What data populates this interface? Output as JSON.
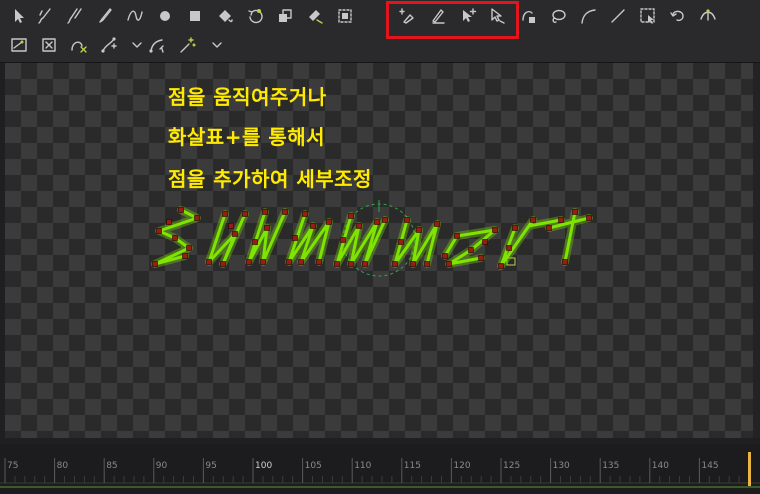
{
  "toolbar": {
    "row1": [
      {
        "id": "select",
        "icon": "arrow-select-icon"
      },
      {
        "id": "brush-a",
        "icon": "paint-brush-icon"
      },
      {
        "id": "brush-b",
        "icon": "multi-stroke-brush-icon"
      },
      {
        "id": "brush-c",
        "icon": "pencil-brush-icon"
      },
      {
        "id": "curve",
        "icon": "bezier-curve-icon"
      },
      {
        "id": "circle",
        "icon": "circle-icon"
      },
      {
        "id": "square",
        "icon": "square-icon"
      },
      {
        "id": "fill",
        "icon": "fill-bucket-icon"
      },
      {
        "id": "rotate",
        "icon": "rotate-shape-icon"
      },
      {
        "id": "layers",
        "icon": "layer-stack-icon"
      },
      {
        "id": "paint-clear",
        "icon": "paint-clear-icon"
      },
      {
        "id": "frame",
        "icon": "frame-select-icon"
      },
      {
        "id": "add-point",
        "icon": "pen-add-point-icon"
      },
      {
        "id": "pen",
        "icon": "pen-draw-icon"
      },
      {
        "id": "arrow-plus",
        "icon": "arrow-add-point-icon"
      },
      {
        "id": "arrow-modify",
        "icon": "arrow-modify-point-icon"
      },
      {
        "id": "lock-shape",
        "icon": "lock-shape-icon"
      },
      {
        "id": "lasso",
        "icon": "lasso-icon"
      },
      {
        "id": "arc",
        "icon": "arc-tool-icon"
      },
      {
        "id": "line",
        "icon": "line-tool-icon"
      },
      {
        "id": "marquee",
        "icon": "marquee-select-icon"
      },
      {
        "id": "undo-curve",
        "icon": "undo-curve-icon"
      },
      {
        "id": "tangent",
        "icon": "tangent-handle-icon"
      }
    ],
    "row2": [
      {
        "id": "transform-box",
        "icon": "transform-box-icon"
      },
      {
        "id": "delete-box",
        "icon": "delete-box-icon"
      },
      {
        "id": "close-curve",
        "icon": "close-curve-icon"
      },
      {
        "id": "path-points",
        "icon": "path-points-icon"
      },
      {
        "id": "dropdown-1",
        "icon": "chevron-down-icon"
      },
      {
        "id": "path-edit",
        "icon": "path-edit-icon"
      },
      {
        "id": "magic-wand",
        "icon": "magic-wand-icon"
      },
      {
        "id": "dropdown-2",
        "icon": "chevron-down-icon"
      }
    ],
    "highlight_color": "#e3141c"
  },
  "annotations": {
    "line1": "점을 움직여주거나",
    "line2": "화살표+를 통해서",
    "line3": "점을 추가하여 세부조정",
    "color": "#ffea00"
  },
  "artwork": {
    "word": "summer",
    "stroke_color": "#7fe400",
    "point_color": "#9a1c18",
    "guide_color": "#2fa84a"
  },
  "timeline": {
    "ticks": [
      "75",
      "80",
      "85",
      "90",
      "95",
      "100",
      "105",
      "110",
      "115",
      "120",
      "125",
      "130",
      "135",
      "140",
      "145"
    ],
    "major_tick": "100",
    "playhead_color": "#e8b640"
  }
}
